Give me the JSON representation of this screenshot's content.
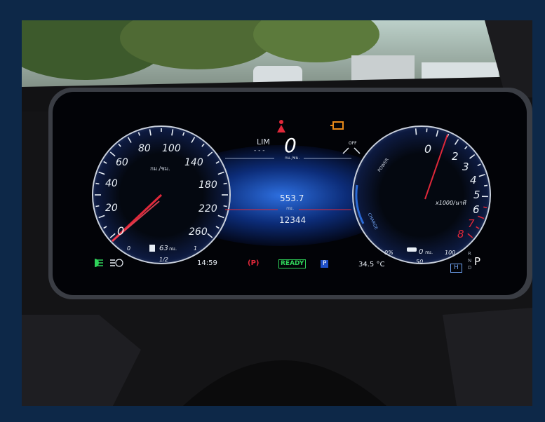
{
  "speedometer": {
    "ticks": [
      "0",
      "20",
      "40",
      "60",
      "80",
      "100",
      "140",
      "180",
      "220",
      "260"
    ],
    "unit": "กม./ชม.",
    "fuel_scale": {
      "empty": "0",
      "half": "1/2",
      "full": "1"
    },
    "range_value": "63",
    "range_unit": "กม.",
    "needle_value": 0
  },
  "center": {
    "limiter_label": "LIM",
    "limiter_value": "- - -",
    "speed": "0",
    "speed_unit": "กม./ชม.",
    "trip": "553.7",
    "trip_unit": "กม.",
    "odometer": "12344",
    "cruise_label": "OFF"
  },
  "power_meter": {
    "ticks": [
      "0",
      "2",
      "3",
      "4",
      "5",
      "6",
      "7",
      "8"
    ],
    "unit": "x1000/นาที",
    "power_label": "POWER",
    "charge_label": "CHARGE",
    "battery_scale": {
      "empty": "0%",
      "mid": "50",
      "full": "100"
    },
    "ev_range_value": "0",
    "ev_range_unit": "กม.",
    "drive_mode": "H"
  },
  "gear": {
    "r": "R",
    "n": "N",
    "d": "D",
    "selected": "P"
  },
  "status_bar": {
    "time": "14:59",
    "parking_brake": "(P)",
    "ready": "READY",
    "park_indicator": "P",
    "temperature": "34.5 °C"
  },
  "colors": {
    "frame": "#0d2848",
    "accent_red": "#e0283a",
    "green": "#2fd35a",
    "blue_glow": "#2a6ad6",
    "amber": "#e88a1a"
  },
  "icons": [
    "headlight-icon",
    "auto-highbeam-icon",
    "fuel-pump-icon",
    "seatbelt-warning-icon",
    "check-engine-icon",
    "cruise-control-icon",
    "ev-car-icon"
  ]
}
